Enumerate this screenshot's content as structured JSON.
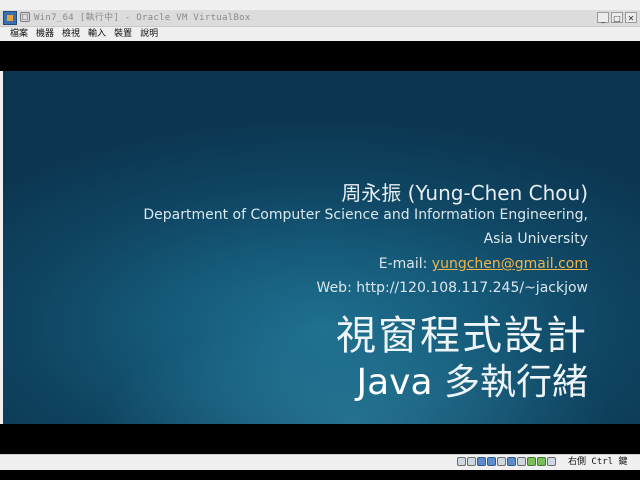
{
  "window": {
    "title": "Win7_64 [執行中] - Oracle VM VirtualBox",
    "sys_icon": "☐",
    "buttons": {
      "minimize": "_",
      "maximize": "□",
      "close": "✕"
    }
  },
  "menu": [
    "檔案",
    "機器",
    "檢視",
    "輸入",
    "裝置",
    "說明"
  ],
  "slide": {
    "author": "周永振 (Yung-Chen Chou)",
    "dept_line1": "Department of Computer Science and Information Engineering,",
    "dept_line2": "Asia University",
    "email_label": "E-mail: ",
    "email": "yungchen@gmail.com",
    "web": "Web: http://120.108.117.245/~jackjow",
    "course": "視窗程式設計",
    "subtitle_java": "Java",
    "subtitle_rest": " 多執行緒"
  },
  "status": {
    "icons": [
      "hdd-icon",
      "optical-icon",
      "usb-icon",
      "network-icon",
      "shared-folder-icon",
      "display-icon",
      "video-capture-icon",
      "cpu-icon",
      "mouse-icon",
      "audio-icon"
    ],
    "host_key": "右側 Ctrl 鍵"
  }
}
